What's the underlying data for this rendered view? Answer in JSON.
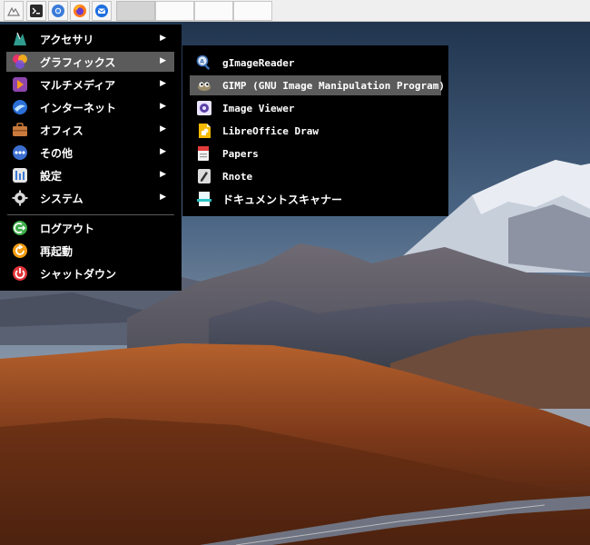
{
  "taskbar": {
    "launchers": [
      {
        "icon": "app-menu-icon"
      },
      {
        "icon": "terminal-icon"
      },
      {
        "icon": "chromium-icon"
      },
      {
        "icon": "firefox-icon"
      },
      {
        "icon": "thunderbird-icon"
      }
    ]
  },
  "main_menu": {
    "categories": [
      {
        "label": "アクセサリ",
        "icon": "accessories-icon",
        "arrow": "▶"
      },
      {
        "label": "グラフィックス",
        "icon": "graphics-icon",
        "arrow": "▶"
      },
      {
        "label": "マルチメディア",
        "icon": "multimedia-icon",
        "arrow": "▶"
      },
      {
        "label": "インターネット",
        "icon": "internet-icon",
        "arrow": "▶"
      },
      {
        "label": "オフィス",
        "icon": "office-icon",
        "arrow": "▶"
      },
      {
        "label": "その他",
        "icon": "other-icon",
        "arrow": "▶"
      },
      {
        "label": "設定",
        "icon": "settings-icon",
        "arrow": "▶"
      },
      {
        "label": "システム",
        "icon": "system-icon",
        "arrow": "▶"
      }
    ],
    "session": [
      {
        "label": "ログアウト",
        "icon": "logout-icon"
      },
      {
        "label": "再起動",
        "icon": "reboot-icon"
      },
      {
        "label": "シャットダウン",
        "icon": "shutdown-icon"
      }
    ]
  },
  "graphics_submenu": {
    "items": [
      {
        "label": "gImageReader",
        "icon": "gimagereader-icon"
      },
      {
        "label": "GIMP (GNU Image Manipulation Program)",
        "icon": "gimp-icon"
      },
      {
        "label": "Image Viewer",
        "icon": "image-viewer-icon"
      },
      {
        "label": "LibreOffice Draw",
        "icon": "libreoffice-draw-icon"
      },
      {
        "label": "Papers",
        "icon": "papers-icon"
      },
      {
        "label": "Rnote",
        "icon": "rnote-icon"
      },
      {
        "label": "ドキュメントスキャナー",
        "icon": "document-scanner-icon"
      }
    ]
  }
}
